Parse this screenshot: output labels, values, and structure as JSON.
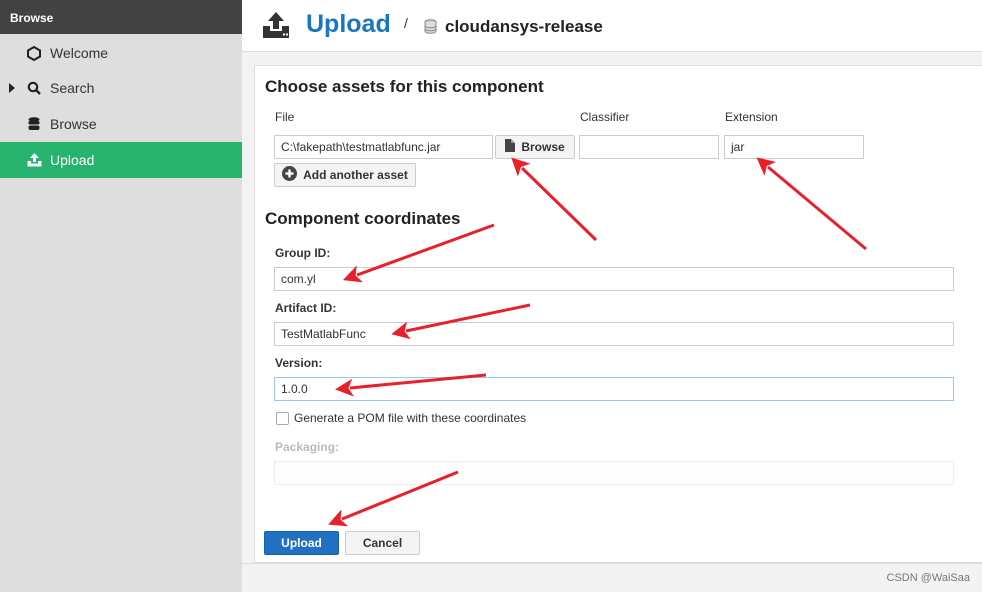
{
  "sidebar": {
    "header": "Browse",
    "items": [
      {
        "label": "Welcome",
        "icon": "hexagon-icon"
      },
      {
        "label": "Search",
        "icon": "search-icon",
        "expandable": true
      },
      {
        "label": "Browse",
        "icon": "database-icon"
      },
      {
        "label": "Upload",
        "icon": "upload-icon",
        "active": true
      }
    ]
  },
  "header": {
    "title": "Upload",
    "separator": "/",
    "repository": "cloudansys-release"
  },
  "assets": {
    "title": "Choose assets for this component",
    "file_label": "File",
    "file_value": "C:\\fakepath\\testmatlabfunc.jar",
    "browse_label": "Browse",
    "classifier_label": "Classifier",
    "classifier_value": "",
    "extension_label": "Extension",
    "extension_value": "jar",
    "add_asset_label": "Add another asset"
  },
  "coordinates": {
    "title": "Component coordinates",
    "group_label": "Group ID:",
    "group_value": "com.yl",
    "artifact_label": "Artifact ID:",
    "artifact_value": "TestMatlabFunc",
    "version_label": "Version:",
    "version_value": "1.0.0",
    "pom_label": "Generate a POM file with these coordinates",
    "pom_checked": false,
    "packaging_label": "Packaging:",
    "packaging_value": ""
  },
  "actions": {
    "upload_label": "Upload",
    "cancel_label": "Cancel"
  },
  "watermark": "CSDN @WaiSaa",
  "colors": {
    "accent": "#27b36e",
    "primary": "#2071c2",
    "title": "#1a75c2",
    "annotation": "#e8202a"
  }
}
